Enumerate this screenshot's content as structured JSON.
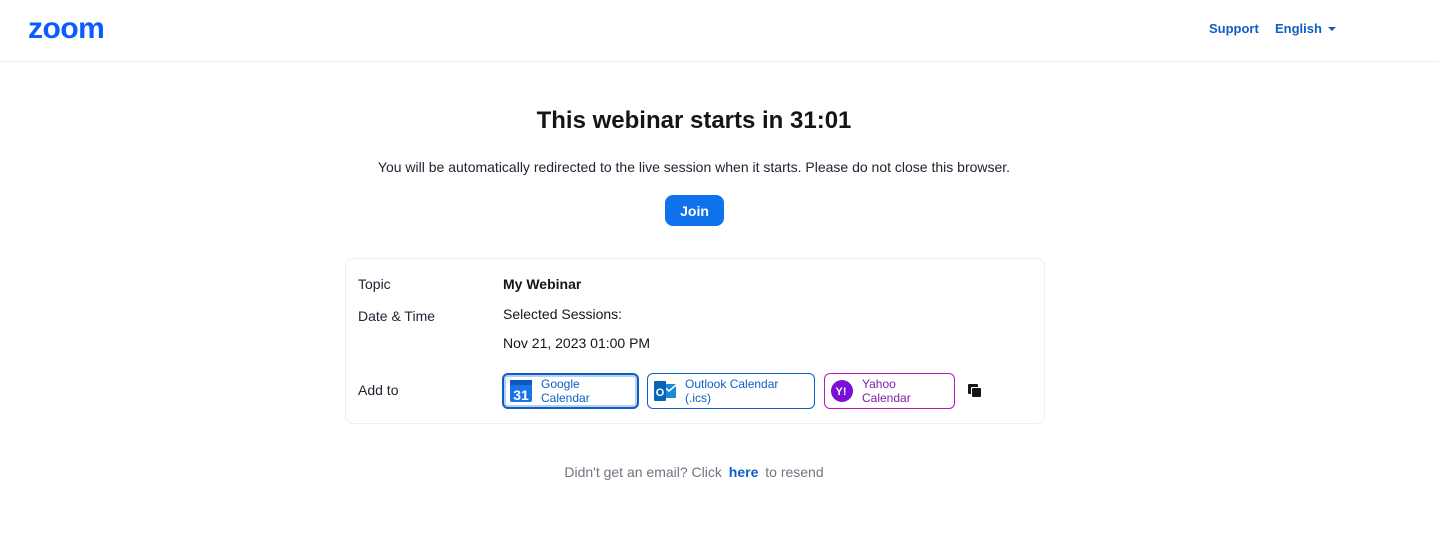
{
  "header": {
    "logo_text": "zoom",
    "support_label": "Support",
    "language_label": "English"
  },
  "main": {
    "title": "This webinar starts in 31:01",
    "subtitle": "You will be automatically redirected to the live session when it starts. Please do not close this browser.",
    "join_label": "Join"
  },
  "details": {
    "topic_label": "Topic",
    "topic_value": "My Webinar",
    "datetime_label": "Date & Time",
    "sessions_label": "Selected Sessions:",
    "session_value": "Nov 21, 2023 01:00 PM",
    "add_to_label": "Add to",
    "calendars": {
      "google": "Google Calendar",
      "outlook": "Outlook Calendar (.ics)",
      "yahoo": "Yahoo Calendar"
    },
    "icons": {
      "google": "google-calendar-icon",
      "outlook": "outlook-icon",
      "yahoo": "yahoo-icon",
      "copy": "copy-icon"
    }
  },
  "footer": {
    "prefix": "Didn't get an email? Click",
    "link": "here",
    "suffix": "to resend"
  },
  "colors": {
    "brand_blue": "#0e72ed",
    "link_blue": "#0e5fc4",
    "yahoo_purple": "#7e1fa6"
  }
}
